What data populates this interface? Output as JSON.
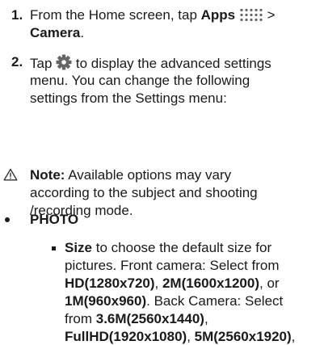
{
  "step1": {
    "num": "1.",
    "text_a": "From the Home screen, tap ",
    "apps": "Apps",
    "sep": " > ",
    "camera": "Camera",
    "period": ".",
    "icon": "apps-grid-icon"
  },
  "step2": {
    "num": "2.",
    "tap": "Tap ",
    "rest": " to display the advanced settings",
    "line2": "menu. You can change the following",
    "line3": "settings from the Settings menu:",
    "icon": "gear-icon"
  },
  "note": {
    "label": "Note:",
    "line1": " Available options may vary",
    "line2": "according to the subject and shooting",
    "line3": "/recording mode.",
    "icon": "warning-icon"
  },
  "photo": {
    "label": "PHOTO"
  },
  "size": {
    "label": "Size",
    "line1": " to choose the default size for",
    "line2": "pictures. Front camera: Select from",
    "hd": "HD(1280x720)",
    "comma": ", ",
    "m2": "2M(1600x1200)",
    "or": ", or",
    "m1": "1M(960x960)",
    "back": ". Back Camera: Select",
    "from": "from ",
    "m36": "3.6M(2560x1440)",
    "c": ",",
    "fhd": "FullHD(1920x1080)",
    "m5": "5M(2560x1920)"
  }
}
